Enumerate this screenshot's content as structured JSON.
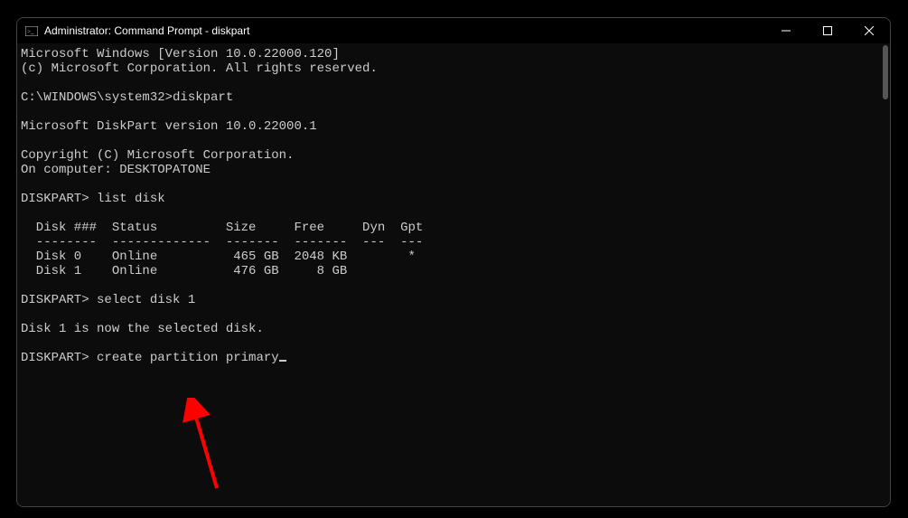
{
  "titlebar": {
    "title": "Administrator: Command Prompt - diskpart"
  },
  "lines": {
    "l0": "Microsoft Windows [Version 10.0.22000.120]",
    "l1": "(c) Microsoft Corporation. All rights reserved.",
    "l2": "",
    "l3": "C:\\WINDOWS\\system32>diskpart",
    "l4": "",
    "l5": "Microsoft DiskPart version 10.0.22000.1",
    "l6": "",
    "l7": "Copyright (C) Microsoft Corporation.",
    "l8": "On computer: DESKTOPATONE",
    "l9": "",
    "l10": "DISKPART> list disk",
    "l11": "",
    "l12": "  Disk ###  Status         Size     Free     Dyn  Gpt",
    "l13": "  --------  -------------  -------  -------  ---  ---",
    "l14": "  Disk 0    Online          465 GB  2048 KB        *",
    "l15": "  Disk 1    Online          476 GB     8 GB",
    "l16": "",
    "l17": "DISKPART> select disk 1",
    "l18": "",
    "l19": "Disk 1 is now the selected disk.",
    "l20": "",
    "l21": "DISKPART> create partition primary"
  }
}
